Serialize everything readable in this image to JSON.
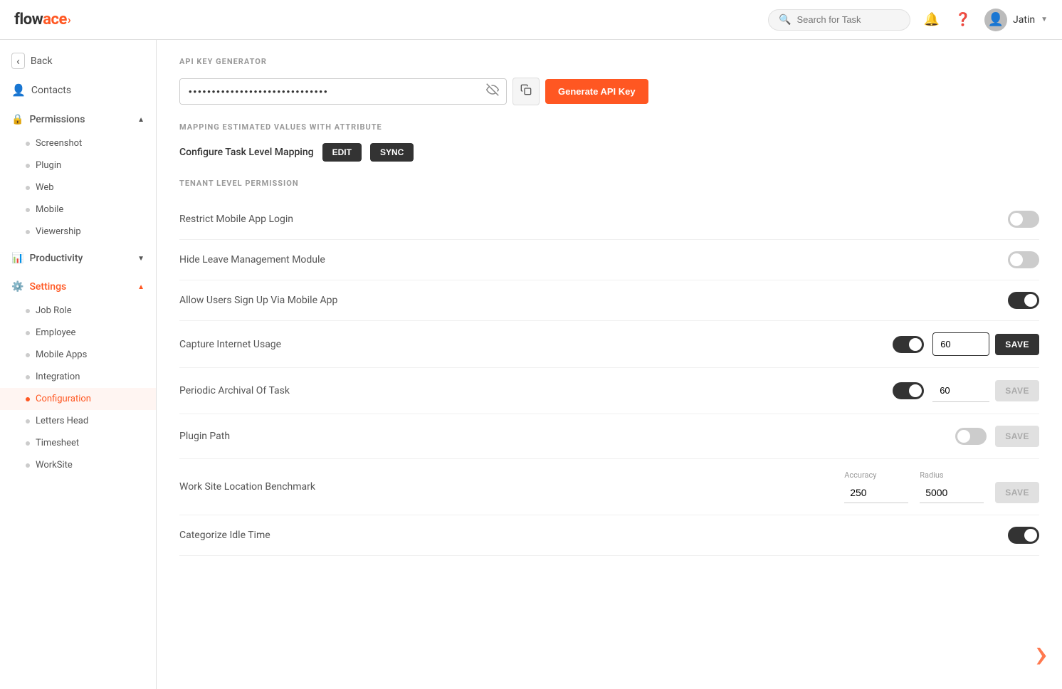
{
  "header": {
    "logo_flow": "flow",
    "logo_ace": "ace",
    "logo_mark": "›",
    "search_placeholder": "Search for Task",
    "user_name": "Jatin"
  },
  "sidebar": {
    "back_label": "Back",
    "contacts_label": "Contacts",
    "permissions_label": "Permissions",
    "permissions_items": [
      {
        "label": "Screenshot",
        "active": false
      },
      {
        "label": "Plugin",
        "active": false
      },
      {
        "label": "Web",
        "active": false
      },
      {
        "label": "Mobile",
        "active": false
      },
      {
        "label": "Viewership",
        "active": false
      }
    ],
    "productivity_label": "Productivity",
    "settings_label": "Settings",
    "settings_items": [
      {
        "label": "Job Role",
        "active": false
      },
      {
        "label": "Employee",
        "active": false
      },
      {
        "label": "Mobile Apps",
        "active": false
      },
      {
        "label": "Integration",
        "active": false
      },
      {
        "label": "Configuration",
        "active": true
      },
      {
        "label": "Letters Head",
        "active": false
      },
      {
        "label": "Timesheet",
        "active": false
      },
      {
        "label": "WorkSite",
        "active": false
      }
    ]
  },
  "content": {
    "api_key_section_title": "API KEY GENERATOR",
    "api_key_value": "••••••••••••••••••••••••••••••",
    "generate_btn_label": "Generate API Key",
    "mapping_section_title": "MAPPING ESTIMATED VALUES WITH ATTRIBUTE",
    "mapping_label": "Configure Task Level Mapping",
    "edit_btn": "EDIT",
    "sync_btn": "SYNC",
    "tenant_section_title": "TENANT LEVEL PERMISSION",
    "permissions": [
      {
        "label": "Restrict Mobile App Login",
        "toggle": false,
        "has_input": false
      },
      {
        "label": "Hide Leave Management Module",
        "toggle": false,
        "has_input": false
      },
      {
        "label": "Allow Users Sign Up Via Mobile App",
        "toggle": true,
        "has_input": false
      },
      {
        "label": "Capture Internet Usage",
        "toggle": true,
        "has_input": true,
        "input_value": "60",
        "save_active": true
      },
      {
        "label": "Periodic Archival Of Task",
        "toggle": true,
        "has_input": true,
        "input_value": "60",
        "save_active": false
      },
      {
        "label": "Plugin Path",
        "toggle": false,
        "has_input": false,
        "has_save_only": true
      }
    ],
    "worksite_label": "Work Site Location Benchmark",
    "accuracy_label": "Accuracy",
    "accuracy_value": "250",
    "radius_label": "Radius",
    "radius_value": "5000",
    "idle_label": "Categorize Idle Time",
    "idle_toggle": true,
    "save_label": "SAVE"
  }
}
